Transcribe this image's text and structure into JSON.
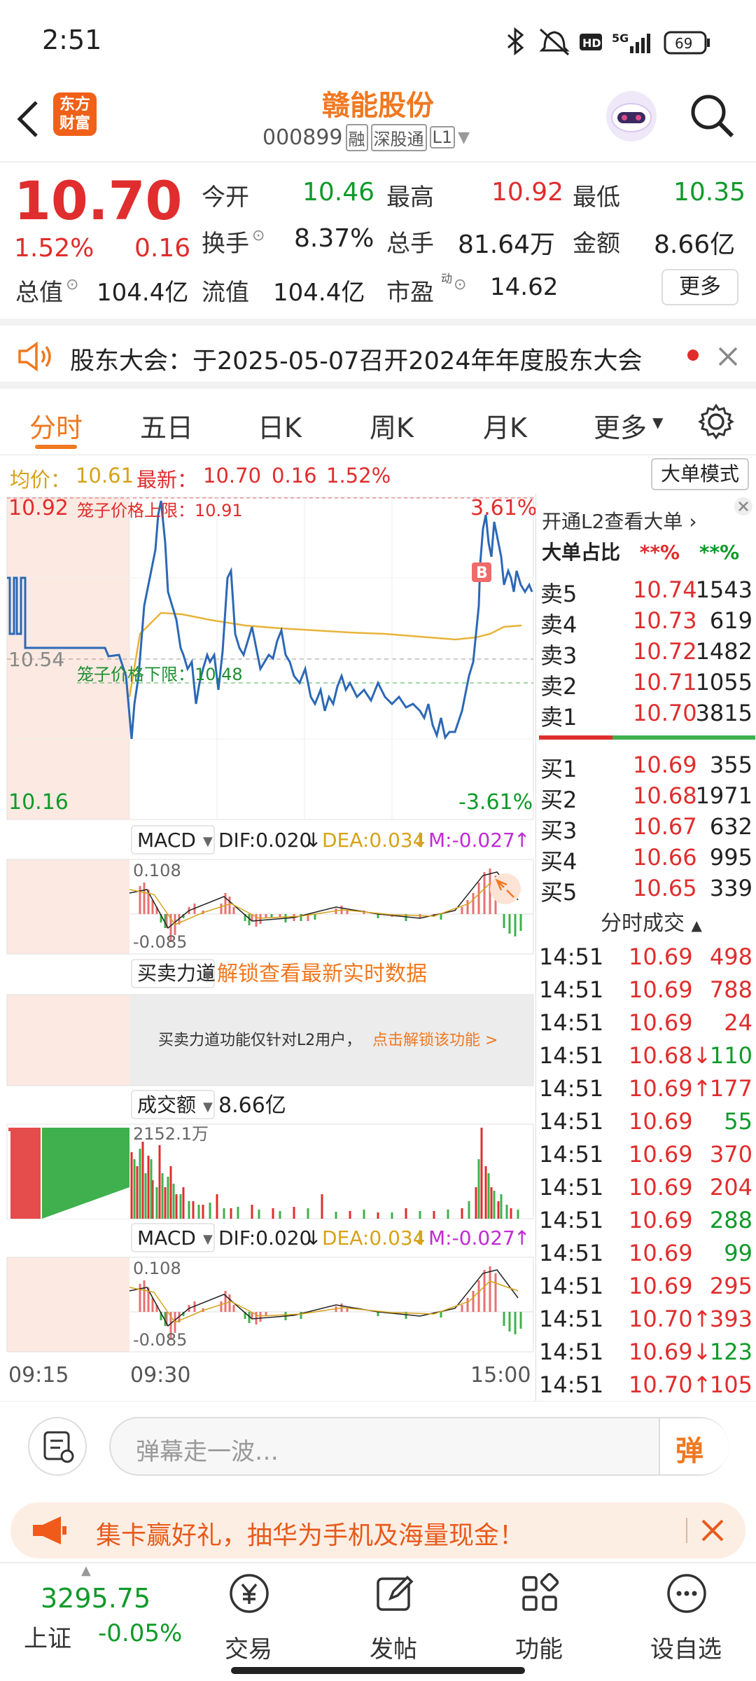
{
  "status": {
    "time": "2:51",
    "battery": "69",
    "network": "5G"
  },
  "header": {
    "title": "赣能股份",
    "code": "000899",
    "badges": [
      "融",
      "深股通",
      "L1"
    ],
    "logo_text": "东方财富"
  },
  "quote": {
    "price": "10.70",
    "change_pct": "1.52%",
    "change": "0.16",
    "open_label": "今开",
    "open": "10.46",
    "high_label": "最高",
    "high": "10.92",
    "low_label": "最低",
    "low": "10.35",
    "turnover_label": "换手",
    "turnover": "8.37%",
    "volume_label": "总手",
    "volume": "81.64万",
    "amount_label": "金额",
    "amount": "8.66亿",
    "mcap_label": "总值",
    "mcap": "104.4亿",
    "float_label": "流值",
    "float": "104.4亿",
    "pe_label": "市盈",
    "pe_sup": "动",
    "pe": "14.62",
    "more_button": "更多"
  },
  "notice": {
    "text": "股东大会：于2025-05-07召开2024年年度股东大会"
  },
  "tabs": [
    "分时",
    "五日",
    "日K",
    "周K",
    "月K",
    "更多"
  ],
  "info": {
    "avg_label": "均价：",
    "avg": "10.61",
    "last_label": "最新：",
    "last": "10.70",
    "change": "0.16",
    "pct": "1.52%",
    "mode_button": "大单模式"
  },
  "chart": {
    "top_price": "10.92",
    "top_pct": "3.61%",
    "mid_price": "10.54",
    "bottom_price": "10.16",
    "bottom_pct": "-3.61%",
    "upper_limit": "笼子价格上限：10.91",
    "lower_limit": "笼子价格下限：10.48",
    "b_marker": "B",
    "macd1": {
      "label": "MACD",
      "dif": "DIF:0.020",
      "dea": "DEA:0.034",
      "m": "M:-0.027",
      "top": "0.108",
      "bottom": "-0.085"
    },
    "power": {
      "label": "买卖力道",
      "unlock": "解锁查看最新实时数据",
      "hint": "买卖力道功能仅针对L2用户，",
      "hint_link": "点击解锁该功能 >"
    },
    "volume": {
      "label": "成交额",
      "value": "8.66亿",
      "max": "2152.1万"
    },
    "macd2": {
      "label": "MACD",
      "dif": "DIF:0.020",
      "dea": "DEA:0.034",
      "m": "M:-0.027",
      "top": "0.108",
      "bottom": "-0.085"
    },
    "times": [
      "09:15",
      "09:30",
      "15:00"
    ]
  },
  "sidepanel": {
    "l2_text": "开通L2查看大单",
    "big_ratio_label": "大单占比",
    "big_ratio_red": "**%",
    "big_ratio_green": "**%",
    "asks": [
      {
        "label": "卖5",
        "price": "10.74",
        "vol": "1543"
      },
      {
        "label": "卖4",
        "price": "10.73",
        "vol": "619"
      },
      {
        "label": "卖3",
        "price": "10.72",
        "vol": "1482"
      },
      {
        "label": "卖2",
        "price": "10.71",
        "vol": "1055"
      },
      {
        "label": "卖1",
        "price": "10.70",
        "vol": "3815"
      }
    ],
    "bids": [
      {
        "label": "买1",
        "price": "10.69",
        "vol": "355"
      },
      {
        "label": "买2",
        "price": "10.68",
        "vol": "1971"
      },
      {
        "label": "买3",
        "price": "10.67",
        "vol": "632"
      },
      {
        "label": "买4",
        "price": "10.66",
        "vol": "995"
      },
      {
        "label": "买5",
        "price": "10.65",
        "vol": "339"
      }
    ],
    "trades_title": "分时成交",
    "trades": [
      {
        "t": "14:51",
        "p": "10.69",
        "pc": "red",
        "v": "498",
        "vc": "red"
      },
      {
        "t": "14:51",
        "p": "10.69",
        "pc": "red",
        "v": "788",
        "vc": "red"
      },
      {
        "t": "14:51",
        "p": "10.69",
        "pc": "red",
        "v": "24",
        "vc": "red"
      },
      {
        "t": "14:51",
        "p": "10.68↓",
        "pc": "red",
        "v": "110",
        "vc": "green"
      },
      {
        "t": "14:51",
        "p": "10.69↑",
        "pc": "red",
        "v": "177",
        "vc": "red"
      },
      {
        "t": "14:51",
        "p": "10.69",
        "pc": "red",
        "v": "55",
        "vc": "green"
      },
      {
        "t": "14:51",
        "p": "10.69",
        "pc": "red",
        "v": "370",
        "vc": "red"
      },
      {
        "t": "14:51",
        "p": "10.69",
        "pc": "red",
        "v": "204",
        "vc": "red"
      },
      {
        "t": "14:51",
        "p": "10.69",
        "pc": "red",
        "v": "288",
        "vc": "green"
      },
      {
        "t": "14:51",
        "p": "10.69",
        "pc": "red",
        "v": "99",
        "vc": "green"
      },
      {
        "t": "14:51",
        "p": "10.69",
        "pc": "red",
        "v": "295",
        "vc": "red"
      },
      {
        "t": "14:51",
        "p": "10.70↑",
        "pc": "red",
        "v": "393",
        "vc": "red"
      },
      {
        "t": "14:51",
        "p": "10.69↓",
        "pc": "red",
        "v": "123",
        "vc": "green"
      },
      {
        "t": "14:51",
        "p": "10.70↑",
        "pc": "red",
        "v": "105",
        "vc": "red"
      }
    ]
  },
  "comment": {
    "placeholder": "弹幕走一波…",
    "danmu_button": "弹"
  },
  "banner": {
    "text": "集卡赢好礼，抽华为手机及海量现金！"
  },
  "bottom": {
    "index_value": "3295.75",
    "index_name": "上证",
    "index_change": "-0.05%",
    "items": [
      "交易",
      "发帖",
      "功能",
      "设自选"
    ]
  },
  "colors": {
    "up": "#e02d2d",
    "down": "#0f9a2a",
    "accent": "#f07820",
    "avg_line": "#e8b339",
    "price_line": "#2c68b5"
  }
}
